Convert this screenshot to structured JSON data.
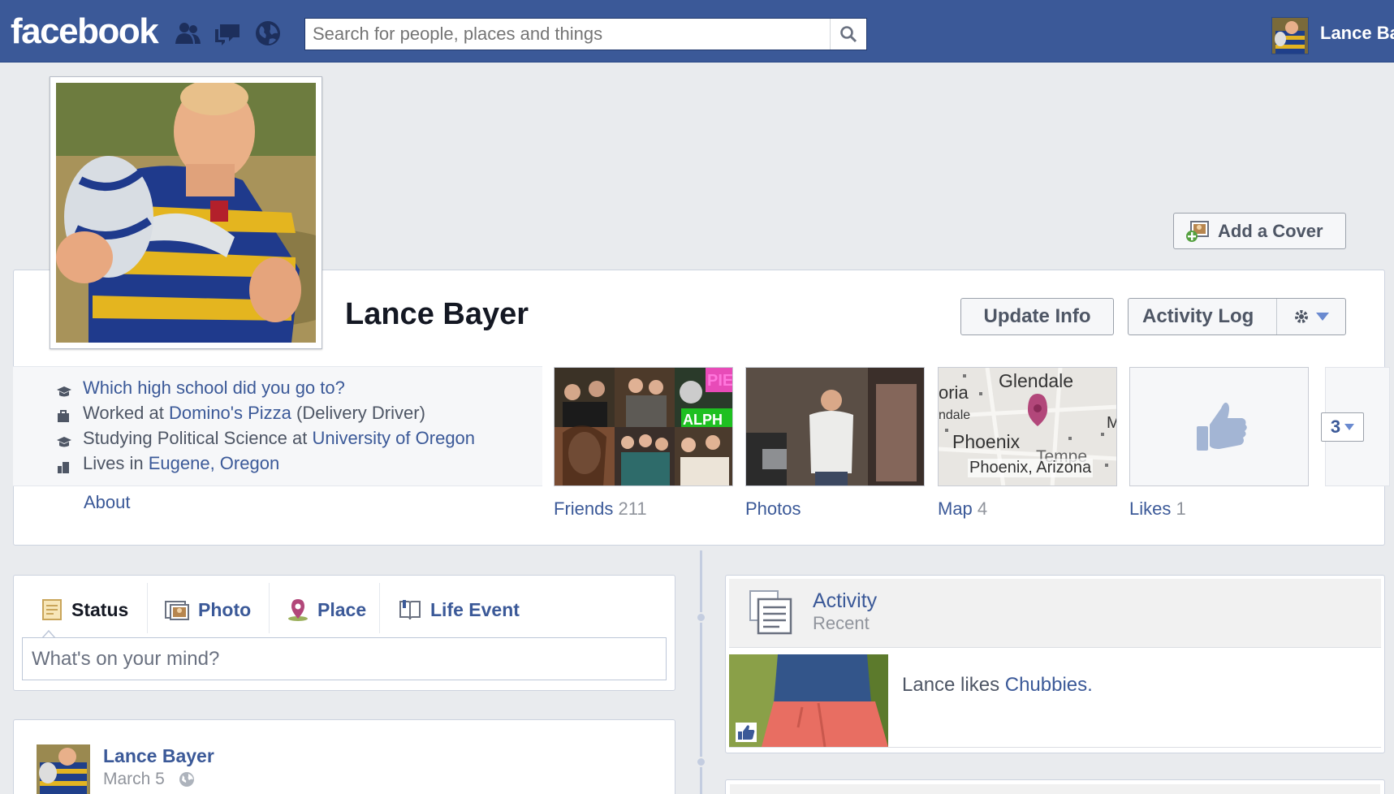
{
  "topbar": {
    "logo": "facebook",
    "search_placeholder": "Search for people, places and things",
    "user_name": "Lance Ba"
  },
  "header": {
    "add_cover": "Add a Cover",
    "name": "Lance Bayer",
    "update_info": "Update Info",
    "activity_log": "Activity Log"
  },
  "info": {
    "school_question": "Which high school did you go to?",
    "work_prefix": "Worked at ",
    "work_place": "Domino's Pizza",
    "work_role": " (Delivery Driver)",
    "study_prefix": "Studying Political Science at ",
    "study_place": "University of Oregon",
    "lives_prefix": "Lives in ",
    "lives_place": "Eugene, Oregon",
    "about": "About"
  },
  "tiles": {
    "friends_label": "Friends",
    "friends_count": "211",
    "photos_label": "Photos",
    "map_label": "Map",
    "map_count": "4",
    "likes_label": "Likes",
    "likes_count": "1",
    "more_count": "3",
    "map_city_glendale": "Glendale",
    "map_city_phoenix": "Phoenix",
    "map_city_tempe": "Tempe",
    "map_caption": "Phoenix, Arizona",
    "map_oria": "oria",
    "map_ndale": "ndale",
    "map_m": "M"
  },
  "composer": {
    "tab_status": "Status",
    "tab_photo": "Photo",
    "tab_place": "Place",
    "tab_life_event": "Life Event",
    "placeholder": "What's on your mind?"
  },
  "post": {
    "author": "Lance Bayer",
    "date": "March 5"
  },
  "activity": {
    "title": "Activity",
    "subtitle": "Recent",
    "text_prefix": "Lance likes ",
    "text_link": "Chubbies."
  },
  "colors": {
    "brand": "#3b5998",
    "background": "#e9ebee"
  }
}
